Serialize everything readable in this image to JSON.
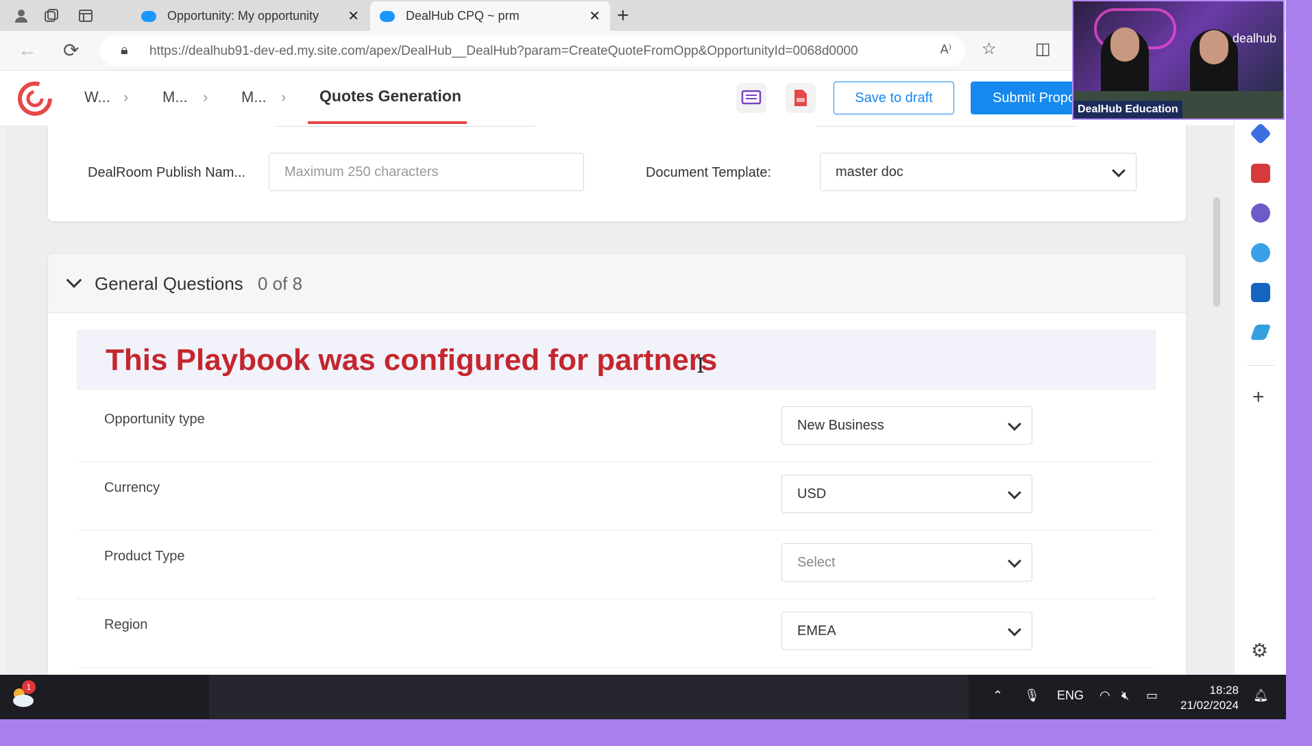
{
  "browser": {
    "tabs": [
      {
        "title": "Opportunity: My opportunity"
      },
      {
        "title": "DealHub CPQ ~ prm"
      }
    ],
    "url": "https://dealhub91-dev-ed.my.site.com/apex/DealHub__DealHub?param=CreateQuoteFromOpp&OpportunityId=0068d0000"
  },
  "app": {
    "breadcrumbs": [
      "W...",
      "M...",
      "M..."
    ],
    "active_page": "Quotes Generation",
    "save_draft_label": "Save to draft",
    "submit_label": "Submit Proposal"
  },
  "top_fields": {
    "dealroom_label": "DealRoom Publish Nam...",
    "dealroom_placeholder": "Maximum 250 characters",
    "template_label": "Document Template:",
    "template_value": "master doc"
  },
  "section": {
    "title": "General Questions",
    "count": "0 of 8",
    "banner": "This Playbook was configured for partners",
    "questions": [
      {
        "label": "Opportunity type",
        "value": "New Business"
      },
      {
        "label": "Currency",
        "value": "USD"
      },
      {
        "label": "Product Type",
        "value": "Select"
      },
      {
        "label": "Region",
        "value": "EMEA"
      }
    ]
  },
  "webcam": {
    "logo": "dealhub",
    "caption": "DealHub Education"
  },
  "taskbar": {
    "notification_count": "1",
    "language": "ENG",
    "time": "18:28",
    "date": "21/02/2024"
  },
  "colors": {
    "brand_red": "#e64848",
    "primary_blue": "#1589ee",
    "banner_text": "#c4262e",
    "frame_purple": "#a97fee"
  }
}
